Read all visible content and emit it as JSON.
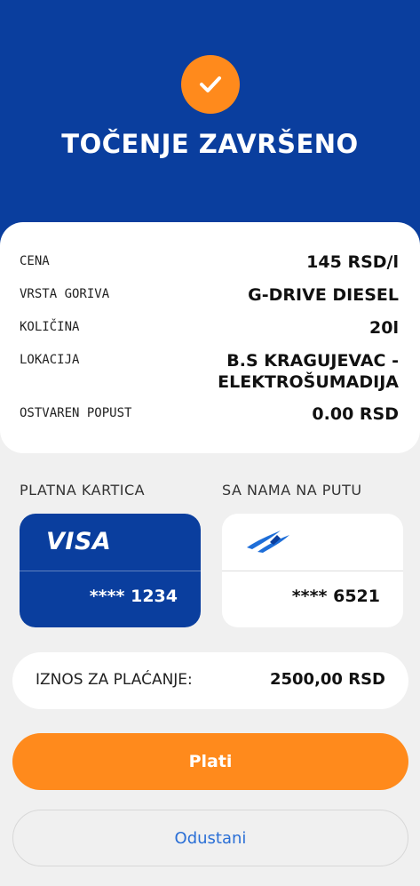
{
  "header": {
    "title": "TOČENJE ZAVRŠENO",
    "status_icon": "checkmark-icon",
    "background_color": "#0a3e9e",
    "accent_color": "#ff8a1c"
  },
  "details": {
    "rows": [
      {
        "label": "CENA",
        "value": "145 RSD/l"
      },
      {
        "label": "VRSTA GORIVA",
        "value": "G-DRIVE DIESEL"
      },
      {
        "label": "KOLIČINA",
        "value": "20l"
      },
      {
        "label": "LOKACIJA",
        "value_line1": "B.S KRAGUJEVAC -",
        "value_line2": "ELEKTROŠUMADIJA"
      },
      {
        "label": "OSTVAREN POPUST",
        "value": "0.00 RSD"
      }
    ]
  },
  "payment_card": {
    "section_label": "PLATNA KARTICA",
    "brand": "VISA",
    "number": "**** 1234"
  },
  "loyalty_card": {
    "section_label": "SA NAMA NA PUTU",
    "logo_icon": "loyalty-logo-icon",
    "number": "**** 6521"
  },
  "amount": {
    "label": "IZNOS ZA PLAĆANJE:",
    "value": "2500,00 RSD"
  },
  "actions": {
    "pay_label": "Plati",
    "cancel_label": "Odustani"
  }
}
